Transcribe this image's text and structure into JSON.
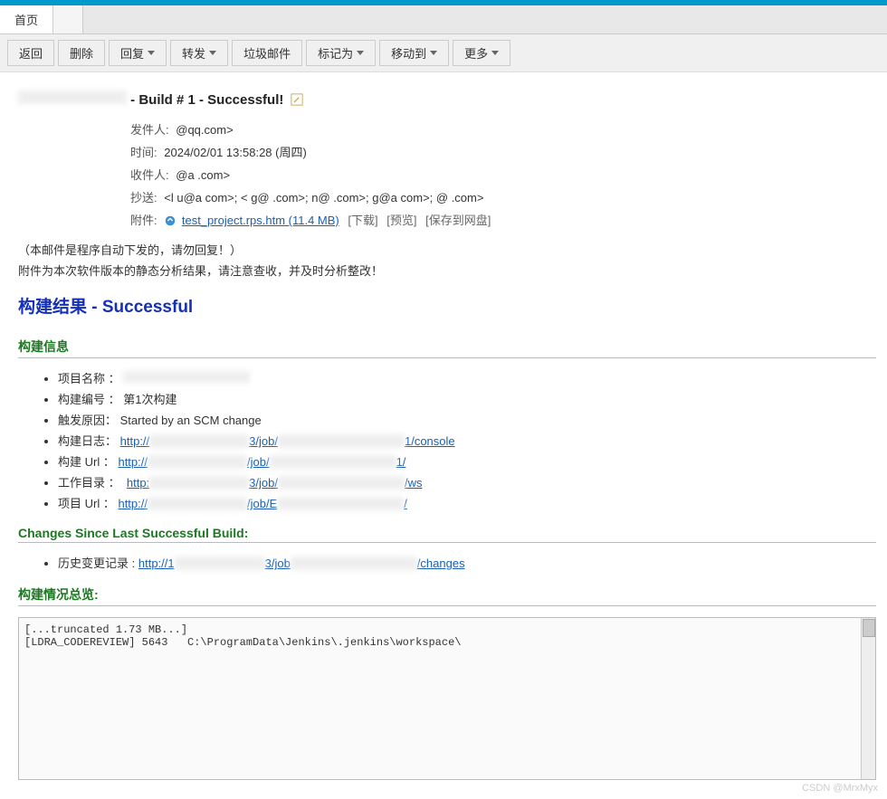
{
  "tabs": {
    "home": "首页",
    "second": "          "
  },
  "toolbar": {
    "back": "返回",
    "delete": "删除",
    "reply": "回复",
    "forward": "转发",
    "spam": "垃圾邮件",
    "mark": "标记为",
    "move": "移动到",
    "more": "更多"
  },
  "subject": {
    "prefix": "           ",
    "text": " - Build # 1 - Successful!"
  },
  "meta": {
    "from_label": "发件人:",
    "from_value": "              @qq.com>",
    "time_label": "时间:",
    "time_value": "2024/02/01 13:58:28 (周四)",
    "to_label": "收件人:",
    "to_value": "         @a        .com>",
    "cc_label": "抄送:",
    "cc_value": "<l        u@a        com>;  <        g@        .com>;             n@        .com>;           g@a        com>;         @        .com>",
    "attach_label": "附件:",
    "attach_name": "test_project.rps.htm (11.4 MB)",
    "attach_download": "[下载]",
    "attach_preview": "[预览]",
    "attach_save": "[保存到网盘]"
  },
  "body": {
    "note1": "（本邮件是程序自动下发的，请勿回复！）",
    "note2": "附件为本次软件版本的静态分析结果，请注意查收，并及时分析整改！",
    "result_title": "构建结果 - Successful",
    "section_info": "构建信息",
    "info": {
      "name_label": "项目名称 ：",
      "name_value": "                          ",
      "num_label": "构建编号 ：",
      "num_value": "第1次构建",
      "cause_label": "触发原因：",
      "cause_value": "Started by an SCM change",
      "log_label": "构建日志：",
      "log_prefix": "http://",
      "log_mid": "3/job/",
      "log_suffix": "1/console",
      "url_label": "构建 Url ：",
      "url_prefix": "http://",
      "url_mid": "/job/",
      "url_suffix": "1/",
      "ws_label": "工作目录 ：",
      "ws_prefix": "http:",
      "ws_mid": "3/job/",
      "ws_suffix": "/ws",
      "proj_label": "项目 Url ：",
      "proj_prefix": "http://",
      "proj_mid": "/job/E",
      "proj_suffix": "/"
    },
    "section_changes": "Changes Since Last Successful Build:",
    "changes": {
      "label": "历史变更记录 :",
      "prefix": "http://1",
      "mid": "3/job",
      "suffix": "/changes"
    },
    "section_overview": "构建情况总览:",
    "log": {
      "line1": "[...truncated 1.73 MB...]",
      "line2": "[LDRA_CODEREVIEW] 5643   C:\\ProgramData\\Jenkins\\.jenkins\\workspace\\"
    }
  },
  "watermark": "CSDN @MrxMyx"
}
